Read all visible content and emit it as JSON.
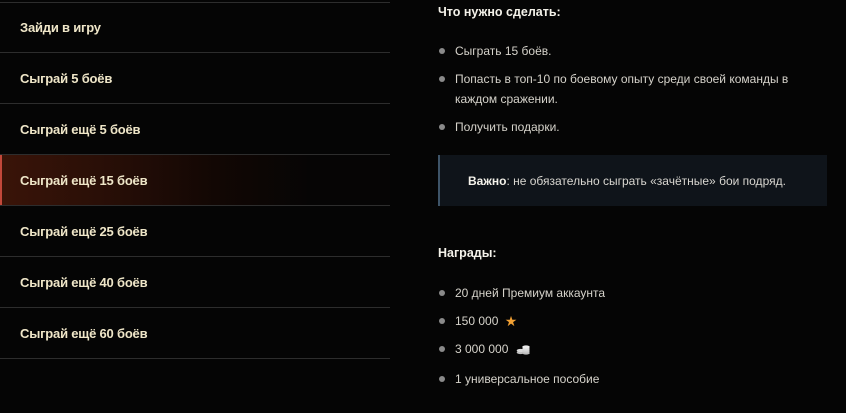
{
  "tasks": [
    {
      "label": "Зайди в игру"
    },
    {
      "label": "Сыграй 5 боёв"
    },
    {
      "label": "Сыграй ещё 5 боёв"
    },
    {
      "label": "Сыграй ещё 15 боёв"
    },
    {
      "label": "Сыграй ещё 25 боёв"
    },
    {
      "label": "Сыграй ещё 40 боёв"
    },
    {
      "label": "Сыграй ещё 60 боёв"
    }
  ],
  "active_task_index": 3,
  "details": {
    "todo_title": "Что нужно сделать:",
    "todo_items": [
      "Сыграть 15 боёв.",
      "Попасть в топ-10 по боевому опыту среди своей команды в каждом сражении.",
      "Получить подарки."
    ],
    "note_label": "Важно",
    "note_text": ": не обязательно сыграть «зачётные» бои подряд.",
    "rewards_title": "Награды:",
    "rewards": {
      "premium": "20 дней Премиум аккаунта",
      "xp": "150 000",
      "xp_icon": "star-icon",
      "credits": "3 000 000",
      "credits_icon": "coins-icon",
      "manual": "1 универсальное пособие"
    }
  },
  "colors": {
    "accent": "#c2483a",
    "star": "#f2a134",
    "note_border": "#3e5468"
  }
}
